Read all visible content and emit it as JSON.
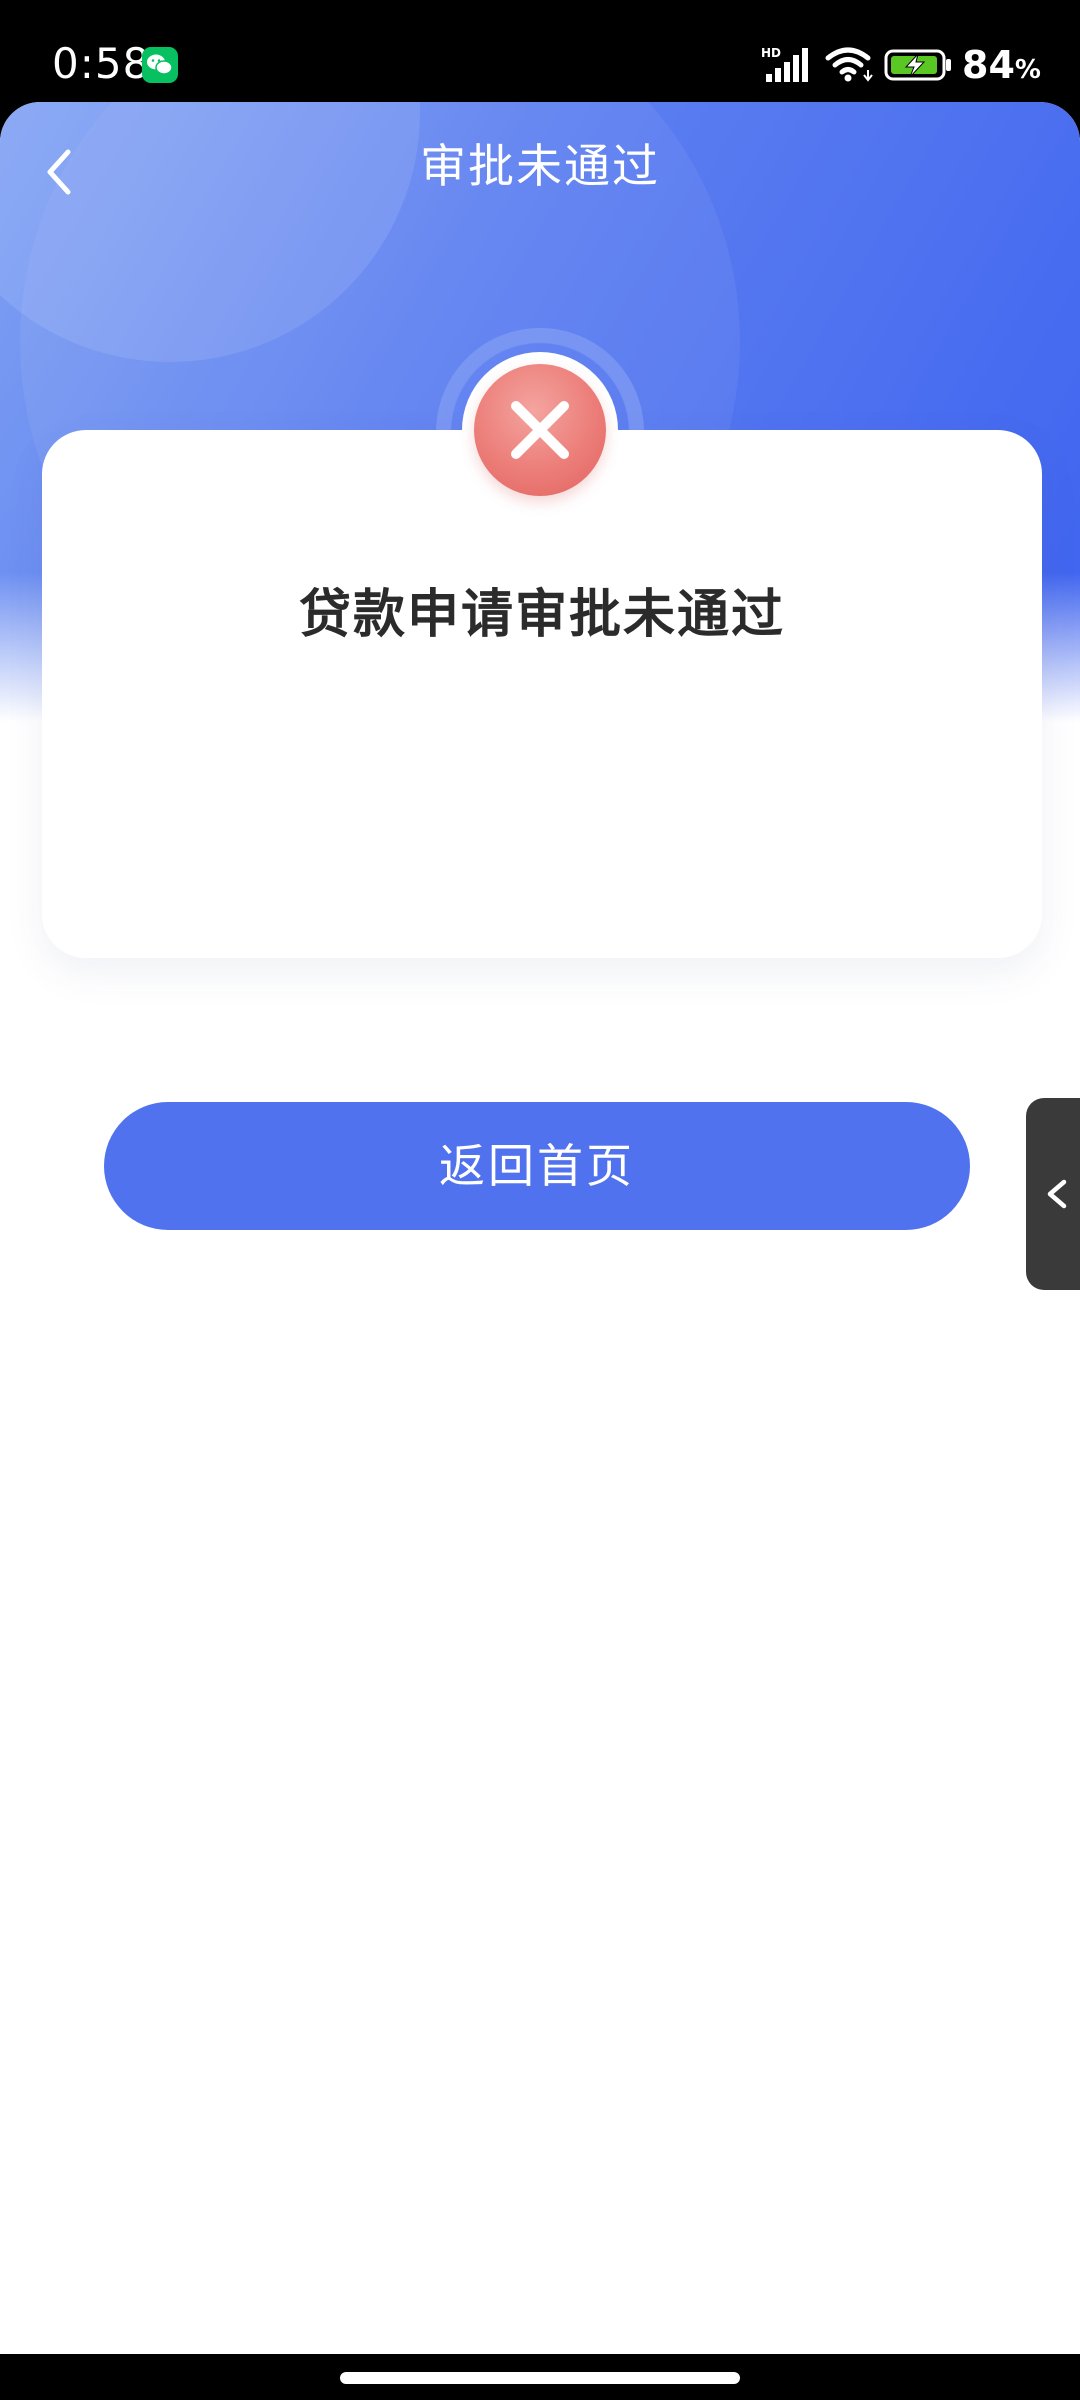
{
  "status_bar": {
    "time": "0:58",
    "network_label": "HD",
    "battery_level": "84",
    "battery_unit": "%",
    "icons": [
      "wechat-icon",
      "signal-icon",
      "wifi-icon",
      "battery-charging-icon"
    ]
  },
  "header": {
    "title": "审批未通过",
    "back_icon": "chevron-left-icon"
  },
  "result_card": {
    "status_icon": "error-x-icon",
    "message": "贷款申请审批未通过"
  },
  "actions": {
    "home_button_label": "返回首页"
  },
  "side_handle": {
    "icon": "chevron-left-icon"
  },
  "colors": {
    "accent": "#5172ee",
    "header_gradient_start": "#7fa1f3",
    "header_gradient_end": "#3e63ef",
    "error": "#ec7d78"
  }
}
